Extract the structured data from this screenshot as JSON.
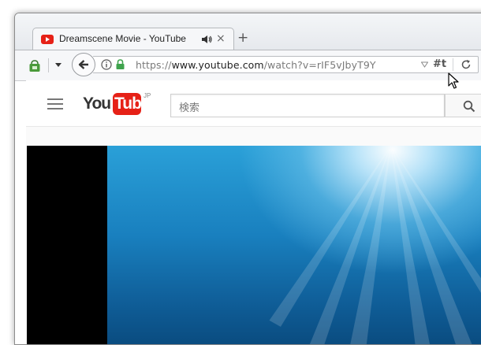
{
  "browser": {
    "tab": {
      "title": "Dreamscene Movie - YouTube",
      "close_glyph": "×"
    },
    "new_tab_glyph": "+",
    "url": {
      "scheme": "https://",
      "host": "www.youtube.com",
      "path": "/watch?v=rIF5vJbyT9Y"
    },
    "hash_button_label": "#t"
  },
  "youtube": {
    "logo": {
      "you": "You",
      "tube": "Tube",
      "region": "JP"
    },
    "search": {
      "placeholder": "検索"
    }
  },
  "icons": {
    "tab_favicon": "youtube-favicon-icon",
    "tab_audio": "speaker-icon",
    "extension": "extension-bag-icon",
    "back": "back-arrow-icon",
    "info": "info-icon",
    "lock": "lock-icon",
    "reload": "reload-icon",
    "menu": "hamburger-menu-icon",
    "search": "search-icon",
    "cursor": "mouse-cursor-icon"
  },
  "colors": {
    "youtube_red": "#e62117",
    "lock_green": "#3fa34d",
    "video_blue": "#1980bf"
  }
}
